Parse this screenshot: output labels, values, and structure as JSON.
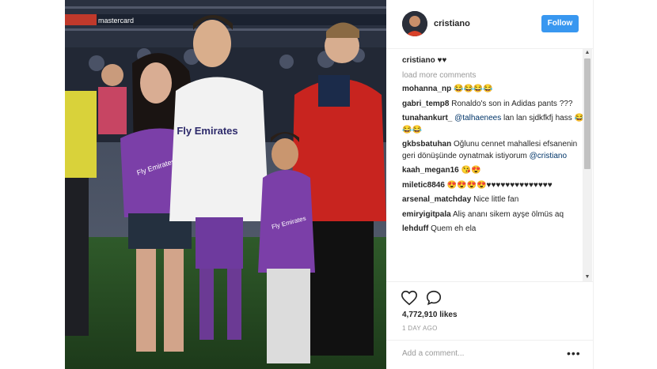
{
  "post": {
    "username": "cristiano",
    "follow_label": "Follow",
    "caption_user": "cristiano",
    "caption_text": "♥♥",
    "load_more": "load more comments",
    "comments": [
      {
        "user": "mohanna_np",
        "parts": [
          {
            "t": "😂😂😂😂"
          }
        ]
      },
      {
        "user": "gabri_temp8",
        "parts": [
          {
            "t": "Ronaldo's son in Adidas pants ???"
          }
        ]
      },
      {
        "user": "tunahankurt_",
        "parts": [
          {
            "t": "@talhaenees",
            "mention": true
          },
          {
            "t": " lan lan sjdkfkfj hass 😂😂😂"
          }
        ]
      },
      {
        "user": "gkbsbatuhan",
        "parts": [
          {
            "t": "Oğlunu cennet mahallesi efsanenin geri dönüşünde oynatmak istiyorum "
          },
          {
            "t": "@cristiano",
            "mention": true
          }
        ]
      },
      {
        "user": "kaah_megan16",
        "parts": [
          {
            "t": "😘😍"
          }
        ]
      },
      {
        "user": "miletic8846",
        "parts": [
          {
            "t": "😍😍😍😍♥♥♥♥♥♥♥♥♥♥♥♥♥♥"
          }
        ]
      },
      {
        "user": "arsenal_matchday",
        "parts": [
          {
            "t": "Nice little fan"
          }
        ]
      },
      {
        "user": "emiryigitpala",
        "parts": [
          {
            "t": "Aliş ananı sikem ayşe ölmüs aq"
          }
        ]
      },
      {
        "user": "lehduff",
        "parts": [
          {
            "t": "Quem eh ela"
          }
        ]
      }
    ],
    "likes": "4,772,910 likes",
    "time": "1 DAY AGO",
    "add_comment_placeholder": "Add a comment...",
    "more_label": "•••"
  },
  "photo": {
    "banner_text": "mastercard",
    "shirt_text": "Fly Emirates",
    "shirt_text_kid": "Fly Emirates",
    "shirt_text_woman": "Fly Emirates"
  },
  "icons": {
    "heart": "heart-icon",
    "comment": "comment-bubble-icon",
    "more": "more-options-icon",
    "scroll_up": "scroll-up-arrow-icon",
    "scroll_down": "scroll-down-arrow-icon"
  },
  "colors": {
    "follow": "#3897f0",
    "mention": "#003569",
    "muted": "#999999",
    "text": "#262626"
  }
}
